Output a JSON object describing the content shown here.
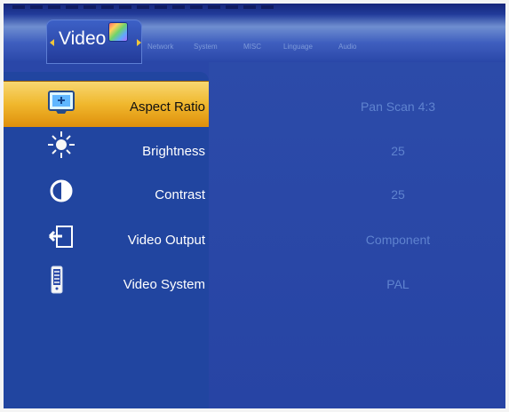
{
  "tabs": {
    "active": "Video",
    "items": [
      "Network",
      "System",
      "MISC",
      "Linguage",
      "Audio"
    ]
  },
  "settings": [
    {
      "label": "Aspect Ratio",
      "value": "Pan Scan 4:3",
      "icon": "aspect-ratio-icon",
      "selected": true
    },
    {
      "label": "Brightness",
      "value": "25",
      "icon": "brightness-icon",
      "selected": false
    },
    {
      "label": "Contrast",
      "value": "25",
      "icon": "contrast-icon",
      "selected": false
    },
    {
      "label": "Video Output",
      "value": "Component",
      "icon": "video-output-icon",
      "selected": false
    },
    {
      "label": "Video System",
      "value": "PAL",
      "icon": "video-system-icon",
      "selected": false
    }
  ],
  "colors": {
    "background": "#2a47a8",
    "highlight": "#f0b82e",
    "muted_value": "#5f83cf",
    "tab_text": "#7e9ad9"
  }
}
